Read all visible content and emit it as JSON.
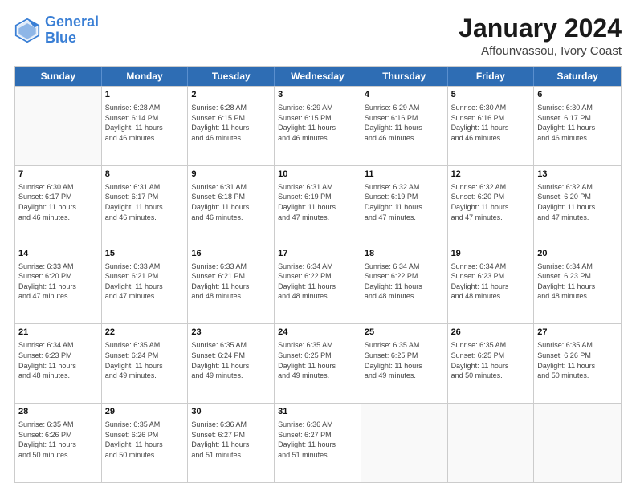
{
  "header": {
    "logo_line1": "General",
    "logo_line2": "Blue",
    "title": "January 2024",
    "subtitle": "Affounvassou, Ivory Coast"
  },
  "days_of_week": [
    "Sunday",
    "Monday",
    "Tuesday",
    "Wednesday",
    "Thursday",
    "Friday",
    "Saturday"
  ],
  "weeks": [
    [
      {
        "day": "",
        "empty": true
      },
      {
        "day": "1",
        "rise": "6:28 AM",
        "set": "6:14 PM",
        "daylight": "11 hours and 46 minutes."
      },
      {
        "day": "2",
        "rise": "6:28 AM",
        "set": "6:15 PM",
        "daylight": "11 hours and 46 minutes."
      },
      {
        "day": "3",
        "rise": "6:29 AM",
        "set": "6:15 PM",
        "daylight": "11 hours and 46 minutes."
      },
      {
        "day": "4",
        "rise": "6:29 AM",
        "set": "6:16 PM",
        "daylight": "11 hours and 46 minutes."
      },
      {
        "day": "5",
        "rise": "6:30 AM",
        "set": "6:16 PM",
        "daylight": "11 hours and 46 minutes."
      },
      {
        "day": "6",
        "rise": "6:30 AM",
        "set": "6:17 PM",
        "daylight": "11 hours and 46 minutes."
      }
    ],
    [
      {
        "day": "7",
        "rise": "6:30 AM",
        "set": "6:17 PM",
        "daylight": "11 hours and 46 minutes."
      },
      {
        "day": "8",
        "rise": "6:31 AM",
        "set": "6:17 PM",
        "daylight": "11 hours and 46 minutes."
      },
      {
        "day": "9",
        "rise": "6:31 AM",
        "set": "6:18 PM",
        "daylight": "11 hours and 46 minutes."
      },
      {
        "day": "10",
        "rise": "6:31 AM",
        "set": "6:19 PM",
        "daylight": "11 hours and 47 minutes."
      },
      {
        "day": "11",
        "rise": "6:32 AM",
        "set": "6:19 PM",
        "daylight": "11 hours and 47 minutes."
      },
      {
        "day": "12",
        "rise": "6:32 AM",
        "set": "6:20 PM",
        "daylight": "11 hours and 47 minutes."
      },
      {
        "day": "13",
        "rise": "6:32 AM",
        "set": "6:20 PM",
        "daylight": "11 hours and 47 minutes."
      }
    ],
    [
      {
        "day": "14",
        "rise": "6:33 AM",
        "set": "6:20 PM",
        "daylight": "11 hours and 47 minutes."
      },
      {
        "day": "15",
        "rise": "6:33 AM",
        "set": "6:21 PM",
        "daylight": "11 hours and 47 minutes."
      },
      {
        "day": "16",
        "rise": "6:33 AM",
        "set": "6:21 PM",
        "daylight": "11 hours and 48 minutes."
      },
      {
        "day": "17",
        "rise": "6:34 AM",
        "set": "6:22 PM",
        "daylight": "11 hours and 48 minutes."
      },
      {
        "day": "18",
        "rise": "6:34 AM",
        "set": "6:22 PM",
        "daylight": "11 hours and 48 minutes."
      },
      {
        "day": "19",
        "rise": "6:34 AM",
        "set": "6:23 PM",
        "daylight": "11 hours and 48 minutes."
      },
      {
        "day": "20",
        "rise": "6:34 AM",
        "set": "6:23 PM",
        "daylight": "11 hours and 48 minutes."
      }
    ],
    [
      {
        "day": "21",
        "rise": "6:34 AM",
        "set": "6:23 PM",
        "daylight": "11 hours and 48 minutes."
      },
      {
        "day": "22",
        "rise": "6:35 AM",
        "set": "6:24 PM",
        "daylight": "11 hours and 49 minutes."
      },
      {
        "day": "23",
        "rise": "6:35 AM",
        "set": "6:24 PM",
        "daylight": "11 hours and 49 minutes."
      },
      {
        "day": "24",
        "rise": "6:35 AM",
        "set": "6:25 PM",
        "daylight": "11 hours and 49 minutes."
      },
      {
        "day": "25",
        "rise": "6:35 AM",
        "set": "6:25 PM",
        "daylight": "11 hours and 49 minutes."
      },
      {
        "day": "26",
        "rise": "6:35 AM",
        "set": "6:25 PM",
        "daylight": "11 hours and 50 minutes."
      },
      {
        "day": "27",
        "rise": "6:35 AM",
        "set": "6:26 PM",
        "daylight": "11 hours and 50 minutes."
      }
    ],
    [
      {
        "day": "28",
        "rise": "6:35 AM",
        "set": "6:26 PM",
        "daylight": "11 hours and 50 minutes."
      },
      {
        "day": "29",
        "rise": "6:35 AM",
        "set": "6:26 PM",
        "daylight": "11 hours and 50 minutes."
      },
      {
        "day": "30",
        "rise": "6:36 AM",
        "set": "6:27 PM",
        "daylight": "11 hours and 51 minutes."
      },
      {
        "day": "31",
        "rise": "6:36 AM",
        "set": "6:27 PM",
        "daylight": "11 hours and 51 minutes."
      },
      {
        "day": "",
        "empty": true
      },
      {
        "day": "",
        "empty": true
      },
      {
        "day": "",
        "empty": true
      }
    ]
  ],
  "labels": {
    "sunrise": "Sunrise:",
    "sunset": "Sunset:",
    "daylight": "Daylight:"
  }
}
